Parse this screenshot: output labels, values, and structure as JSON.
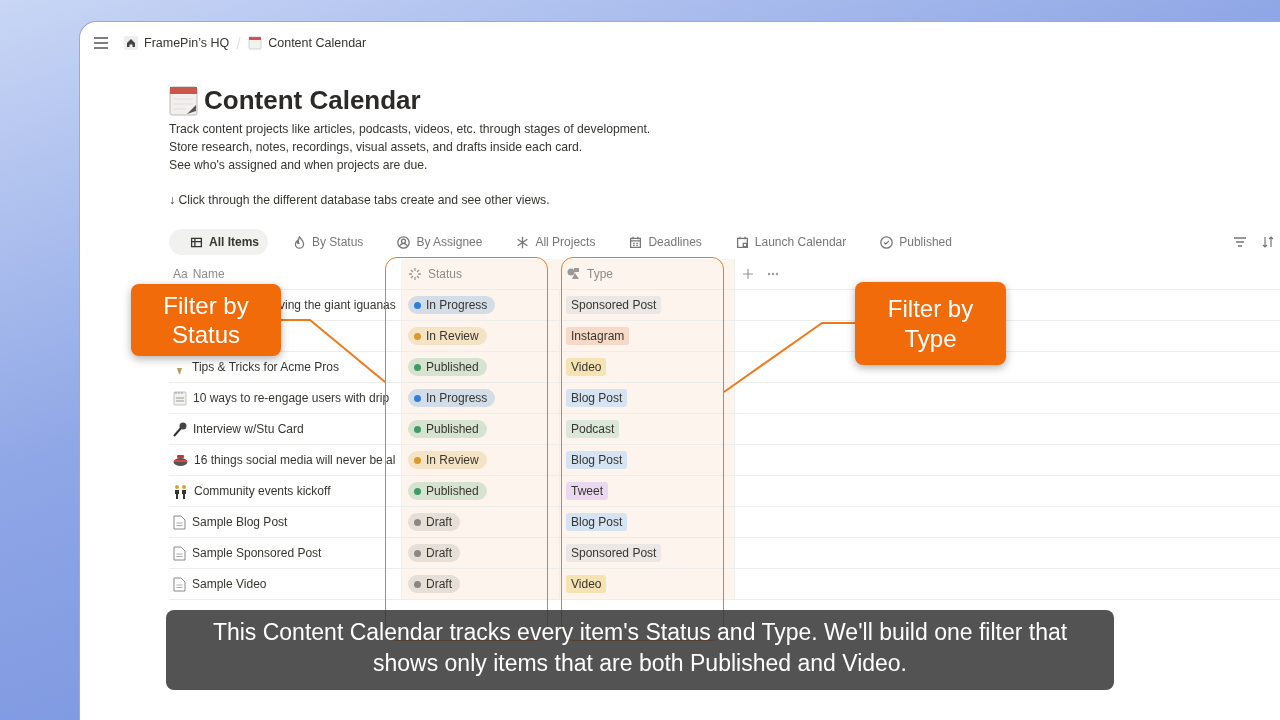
{
  "breadcrumb": [
    {
      "label": "FramePin’s HQ",
      "kind": "home"
    },
    {
      "label": "Content Calendar",
      "kind": "calendar"
    }
  ],
  "page": {
    "title": "Content Calendar",
    "description": [
      "Track content projects like articles, podcasts, videos, etc. through stages of development.",
      "Store research, notes, recordings, visual assets, and drafts inside each card.",
      "See who's assigned and when projects are due."
    ],
    "hint": "↓ Click through the different database tabs create and see other views."
  },
  "tabs": [
    {
      "label": "All Items",
      "selected": true
    },
    {
      "label": "By Status",
      "selected": false
    },
    {
      "label": "By Assignee",
      "selected": false
    },
    {
      "label": "All Projects",
      "selected": false
    },
    {
      "label": "Deadlines",
      "selected": false
    },
    {
      "label": "Launch Calendar",
      "selected": false
    },
    {
      "label": "Published",
      "selected": false
    }
  ],
  "table": {
    "columns": [
      {
        "label": "Name",
        "glyph": "Aa"
      },
      {
        "label": "Status"
      },
      {
        "label": "Type"
      }
    ],
    "rows": [
      {
        "name": "ving the giant iguanas",
        "kind": "hidden",
        "status": {
          "label": "In Progress",
          "color": "#2f7fd8"
        },
        "type": {
          "label": "Sponsored Post",
          "color": "#ebe7e4"
        }
      },
      {
        "kind": "hidden",
        "status": {
          "label": "In Review",
          "color": "#d99a2b"
        },
        "type": {
          "label": "Instagram",
          "color": "#f6d9c7"
        }
      },
      {
        "name": "Tips & Tricks for Acme Pros",
        "kind": "bulb",
        "status": {
          "label": "Published",
          "color": "#3f9a64"
        },
        "type": {
          "label": "Video",
          "color": "#f6e3b4"
        }
      },
      {
        "name": "10 ways to re-engage users with drip",
        "kind": "note",
        "status": {
          "label": "In Progress",
          "color": "#2f7fd8"
        },
        "type": {
          "label": "Blog Post",
          "color": "#d5e3f2"
        }
      },
      {
        "name": "Interview w/Stu Card",
        "kind": "mic",
        "status": {
          "label": "Published",
          "color": "#3f9a64"
        },
        "type": {
          "label": "Podcast",
          "color": "#dbe8d9"
        }
      },
      {
        "name": "16 things social media will never be al",
        "kind": "stone",
        "status": {
          "label": "In Review",
          "color": "#d99a2b"
        },
        "type": {
          "label": "Blog Post",
          "color": "#d5e3f2"
        }
      },
      {
        "name": "Community events kickoff",
        "kind": "people",
        "status": {
          "label": "Published",
          "color": "#3f9a64"
        },
        "type": {
          "label": "Tweet",
          "color": "#ead9ef"
        }
      },
      {
        "name": "Sample Blog Post",
        "kind": "page",
        "status": {
          "label": "Draft",
          "color": "#8c8784"
        },
        "type": {
          "label": "Blog Post",
          "color": "#d5e3f2"
        }
      },
      {
        "name": "Sample Sponsored Post",
        "kind": "page",
        "status": {
          "label": "Draft",
          "color": "#8c8784"
        },
        "type": {
          "label": "Sponsored Post",
          "color": "#ebe7e4"
        }
      },
      {
        "name": "Sample Video",
        "kind": "page",
        "status": {
          "label": "Draft",
          "color": "#8c8784"
        },
        "type": {
          "label": "Video",
          "color": "#f6e3b4"
        }
      }
    ]
  },
  "callouts": [
    {
      "text": "Filter by Status"
    },
    {
      "text": "Filter by Type"
    }
  ],
  "subtitle": "This Content Calendar tracks every item's Status and Type. We'll build one filter that shows only items that are both Published and Video."
}
